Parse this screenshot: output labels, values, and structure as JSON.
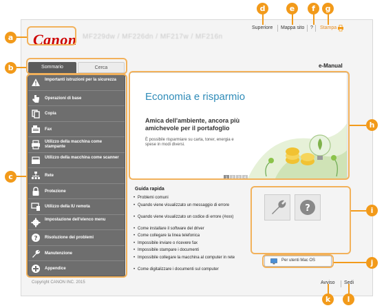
{
  "header": {
    "logo": "Canon",
    "model": "MF229dw / MF226dn / MF217w / MF216n",
    "links": {
      "top": "Superiore",
      "sitemap": "Mappa sito",
      "help": "?",
      "print": "Stampa"
    }
  },
  "tabs": {
    "contents": "Sommario",
    "search": "Cerca"
  },
  "title": "e-Manual",
  "nav": [
    {
      "label": "Importanti istruzioni per la sicurezza",
      "icon": "warning-icon"
    },
    {
      "label": "Operazioni di base",
      "icon": "hand-icon"
    },
    {
      "label": "Copia",
      "icon": "copy-icon"
    },
    {
      "label": "Fax",
      "icon": "fax-icon"
    },
    {
      "label": "Utilizzo della macchina come stampante",
      "icon": "printer-icon"
    },
    {
      "label": "Utilizzo della macchina come scanner",
      "icon": "scanner-icon"
    },
    {
      "label": "Rete",
      "icon": "network-icon"
    },
    {
      "label": "Protezione",
      "icon": "lock-icon"
    },
    {
      "label": "Utilizzo della IU remota",
      "icon": "remote-ui-icon"
    },
    {
      "label": "Impostazione dell'elenco menu",
      "icon": "settings-icon"
    },
    {
      "label": "Risoluzione dei problemi",
      "icon": "question-icon"
    },
    {
      "label": "Manutenzione",
      "icon": "wrench-icon"
    },
    {
      "label": "Appendice",
      "icon": "plus-icon"
    }
  ],
  "banner": {
    "headline": "Economia e risparmio",
    "subhead": "Amica dell'ambiente, ancora più amichevole per il portafoglio",
    "body": "È possibile risparmiare su carta, toner, energia e spese in modi diversi.",
    "pages": [
      "1",
      "2",
      "3",
      "4"
    ]
  },
  "guide": {
    "title": "Guida rapida",
    "items": [
      "Problemi comuni",
      "Quando viene visualizzato un messaggio di errore",
      "Quando viene visualizzato un codice di errore (#xxx)",
      "Come installare il software del driver",
      "Come collegare la linea telefonica",
      "Impossibile inviare o ricevere fax",
      "Impossibile stampare i documenti",
      "Impossibile collegare la macchina al computer in rete",
      "Come digitalizzare i documenti sul computer"
    ],
    "mac_button": "Per utenti Mac OS"
  },
  "footer": {
    "copyright": "Copyright CANON INC. 2015",
    "notice": "Avviso",
    "offices": "Sedi"
  },
  "callouts": [
    "a",
    "b",
    "c",
    "d",
    "e",
    "f",
    "g",
    "h",
    "i",
    "j",
    "k",
    "l"
  ],
  "colors": {
    "callout": "#f29a1a",
    "logo": "#cc0000",
    "banner_title": "#2e8bb8",
    "sidebar": "#6e6e6e"
  }
}
